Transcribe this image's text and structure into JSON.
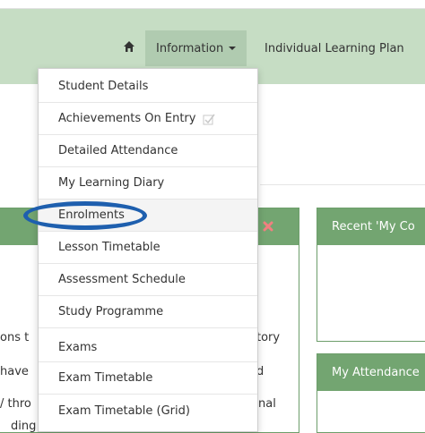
{
  "nav": {
    "home_icon": "home-icon",
    "information_label": "Information",
    "ilp_label": "Individual Learning Plan"
  },
  "dropdown": {
    "items": [
      {
        "label": "Student Details"
      },
      {
        "label": "Achievements On Entry",
        "icon": "check-icon"
      },
      {
        "label": "Detailed Attendance"
      },
      {
        "label": "My Learning Diary"
      },
      {
        "label": "Enrolments"
      },
      {
        "label": "Lesson Timetable"
      },
      {
        "label": "Assessment Schedule"
      },
      {
        "label": "Study Programme"
      },
      {
        "label": "Exams"
      },
      {
        "label": "Exam Timetable"
      },
      {
        "label": "Exam Timetable (Grid)"
      }
    ]
  },
  "panels": {
    "recent_title": "Recent 'My Co",
    "attendance_title": "My Attendance"
  },
  "background_text": {
    "line1_left": "ons t",
    "line1_right": "tory",
    "line2_left": "have",
    "line2_right": "d",
    "line3_left": "/ thro",
    "line3_right": "nal",
    "line4": "ding organisations."
  },
  "colors": {
    "navbar": "#c6ddc4",
    "panel_header": "#73a571",
    "annotation_circle": "#1e5fae",
    "close_icon": "#f08080"
  }
}
